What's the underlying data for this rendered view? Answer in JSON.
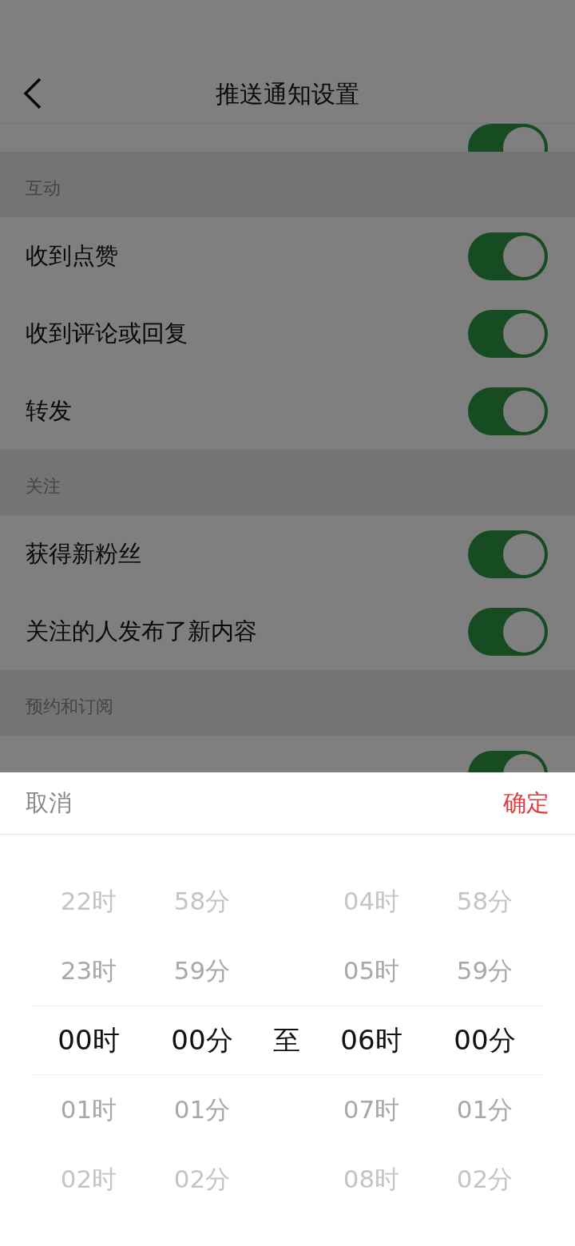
{
  "header": {
    "title": "推送通知设置"
  },
  "scrolled_row": {
    "on": true
  },
  "sections": [
    {
      "title": "互动",
      "items": [
        {
          "label": "收到点赞",
          "on": true
        },
        {
          "label": "收到评论或回复",
          "on": true
        },
        {
          "label": "转发",
          "on": true
        }
      ]
    },
    {
      "title": "关注",
      "items": [
        {
          "label": "获得新粉丝",
          "on": true
        },
        {
          "label": "关注的人发布了新内容",
          "on": true
        }
      ]
    },
    {
      "title": "预约和订阅",
      "items": [
        {
          "on": true
        }
      ]
    }
  ],
  "sheet": {
    "cancel": "取消",
    "confirm": "确定",
    "columns": [
      {
        "kind": "wheel",
        "options": [
          {
            "label": "22时",
            "selected": false
          },
          {
            "label": "23时",
            "selected": false
          },
          {
            "label": "00时",
            "selected": true
          },
          {
            "label": "01时",
            "selected": false
          },
          {
            "label": "02时",
            "selected": false
          }
        ]
      },
      {
        "kind": "wheel",
        "options": [
          {
            "label": "58分",
            "selected": false
          },
          {
            "label": "59分",
            "selected": false
          },
          {
            "label": "00分",
            "selected": true
          },
          {
            "label": "01分",
            "selected": false
          },
          {
            "label": "02分",
            "selected": false
          }
        ]
      },
      {
        "kind": "separator",
        "label": "至"
      },
      {
        "kind": "wheel",
        "options": [
          {
            "label": "04时",
            "selected": false
          },
          {
            "label": "05时",
            "selected": false
          },
          {
            "label": "06时",
            "selected": true
          },
          {
            "label": "07时",
            "selected": false
          },
          {
            "label": "08时",
            "selected": false
          }
        ]
      },
      {
        "kind": "wheel",
        "options": [
          {
            "label": "58分",
            "selected": false
          },
          {
            "label": "59分",
            "selected": false
          },
          {
            "label": "00分",
            "selected": true
          },
          {
            "label": "01分",
            "selected": false
          },
          {
            "label": "02分",
            "selected": false
          }
        ]
      }
    ]
  }
}
